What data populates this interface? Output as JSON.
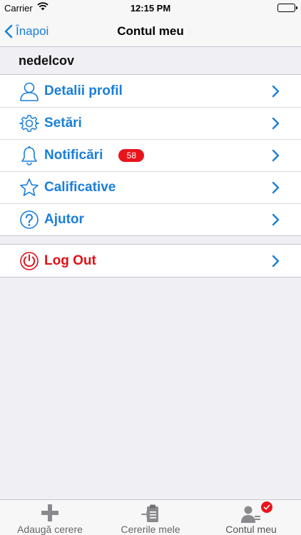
{
  "status_bar": {
    "carrier": "Carrier",
    "time": "12:15 PM"
  },
  "nav": {
    "back_label": "Înapoi",
    "title": "Contul meu"
  },
  "user": {
    "username": "nedelcov"
  },
  "menu": {
    "items": [
      {
        "label": "Detalii profil",
        "icon": "person-icon"
      },
      {
        "label": "Setări",
        "icon": "gear-icon"
      },
      {
        "label": "Notificări",
        "icon": "bell-icon",
        "badge": "58"
      },
      {
        "label": "Calificative",
        "icon": "star-icon"
      },
      {
        "label": "Ajutor",
        "icon": "help-icon"
      }
    ]
  },
  "logout": {
    "label": "Log Out",
    "icon": "power-icon"
  },
  "tabs": [
    {
      "label": "Adaugă cerere",
      "icon": "plus-icon"
    },
    {
      "label": "Cererile mele",
      "icon": "clipboard-icon"
    },
    {
      "label": "Contul meu",
      "icon": "account-icon"
    }
  ],
  "colors": {
    "accent": "#1a7fd9",
    "danger": "#e01218",
    "badge": "#e8141c"
  }
}
